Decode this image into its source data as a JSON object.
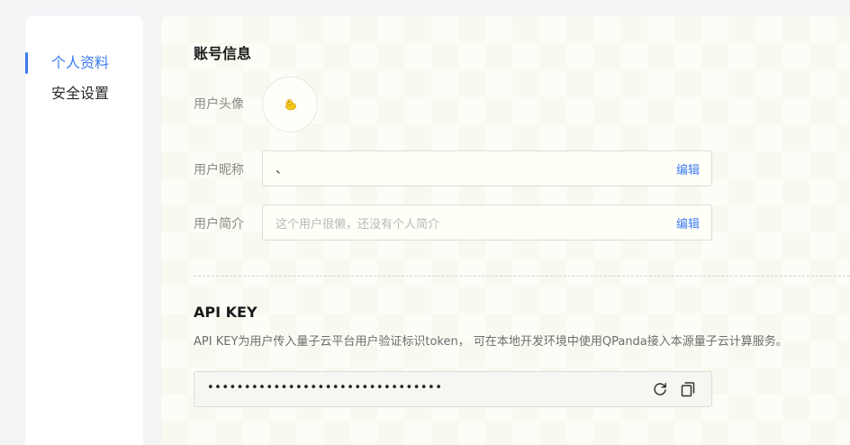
{
  "sidebar": {
    "items": [
      {
        "label": "个人资料",
        "active": true
      },
      {
        "label": "安全设置",
        "active": false
      }
    ]
  },
  "account": {
    "title": "账号信息",
    "avatar_label": "用户头像",
    "nickname_label": "用户昵称",
    "nickname_value": "、",
    "nickname_edit": "编辑",
    "bio_label": "用户简介",
    "bio_placeholder": "这个用户很懒，还没有个人简介",
    "bio_edit": "编辑"
  },
  "api": {
    "title": "API KEY",
    "description": "API KEY为用户传入量子云平台用户验证标识token， 可在本地开发环境中使用QPanda接入本源量子云计算服务。",
    "key_masked": "••••••••••••••••••••••••••••••••",
    "refresh_icon": "refresh-icon",
    "copy_icon": "copy-icon"
  },
  "colors": {
    "accent": "#3c7cf0"
  }
}
